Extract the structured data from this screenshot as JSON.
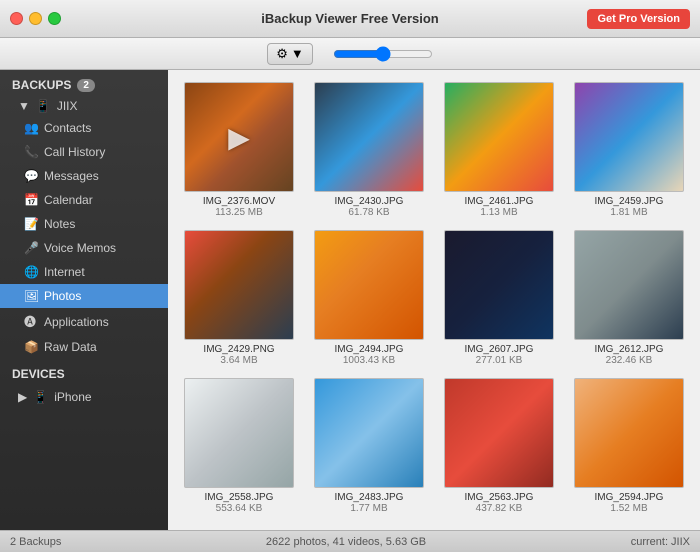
{
  "titlebar": {
    "title": "iBackup Viewer Free Version",
    "pro_button_label": "Get Pro Version"
  },
  "toolbar": {
    "gear_label": "⚙",
    "dropdown_arrow": "▼"
  },
  "sidebar": {
    "backups_label": "BACKUPS",
    "backups_count": "2",
    "device_name": "JIIX",
    "nav_items": [
      {
        "id": "contacts",
        "label": "Contacts",
        "icon": "👥"
      },
      {
        "id": "call-history",
        "label": "Call History",
        "icon": "📞"
      },
      {
        "id": "messages",
        "label": "Messages",
        "icon": "💬"
      },
      {
        "id": "calendar",
        "label": "Calendar",
        "icon": "📅"
      },
      {
        "id": "notes",
        "label": "Notes",
        "icon": "📝"
      },
      {
        "id": "voice-memos",
        "label": "Voice Memos",
        "icon": "🎤"
      },
      {
        "id": "internet",
        "label": "Internet",
        "icon": "🌐"
      },
      {
        "id": "photos",
        "label": "Photos",
        "icon": "🖼"
      },
      {
        "id": "applications",
        "label": "Applications",
        "icon": "🅐"
      },
      {
        "id": "raw-data",
        "label": "Raw Data",
        "icon": "📦"
      }
    ],
    "devices_label": "DEVICES",
    "device_items": [
      {
        "id": "iphone",
        "label": "iPhone",
        "icon": "📱"
      }
    ]
  },
  "photos": [
    {
      "name": "IMG_2376.MOV",
      "size": "113.25 MB",
      "thumb_class": "thumb-1",
      "is_video": true
    },
    {
      "name": "IMG_2430.JPG",
      "size": "61.78 KB",
      "thumb_class": "thumb-2",
      "is_video": false
    },
    {
      "name": "IMG_2461.JPG",
      "size": "1.13 MB",
      "thumb_class": "thumb-3",
      "is_video": false
    },
    {
      "name": "IMG_2459.JPG",
      "size": "1.81 MB",
      "thumb_class": "thumb-4",
      "is_video": false
    },
    {
      "name": "IMG_2429.PNG",
      "size": "3.64 MB",
      "thumb_class": "thumb-5",
      "is_video": false
    },
    {
      "name": "IMG_2494.JPG",
      "size": "1003.43 KB",
      "thumb_class": "thumb-6",
      "is_video": false
    },
    {
      "name": "IMG_2607.JPG",
      "size": "277.01 KB",
      "thumb_class": "thumb-7",
      "is_video": false
    },
    {
      "name": "IMG_2612.JPG",
      "size": "232.46 KB",
      "thumb_class": "thumb-8",
      "is_video": false
    },
    {
      "name": "IMG_2558.JPG",
      "size": "553.64 KB",
      "thumb_class": "thumb-9",
      "is_video": false
    },
    {
      "name": "IMG_2483.JPG",
      "size": "1.77 MB",
      "thumb_class": "thumb-10",
      "is_video": false
    },
    {
      "name": "IMG_2563.JPG",
      "size": "437.82 KB",
      "thumb_class": "thumb-11",
      "is_video": false
    },
    {
      "name": "IMG_2594.JPG",
      "size": "1.52 MB",
      "thumb_class": "thumb-12",
      "is_video": false
    }
  ],
  "statusbar": {
    "backups_count": "2 Backups",
    "photo_info": "2622 photos, 41 videos, 5.63 GB",
    "current": "current: JIIX"
  }
}
